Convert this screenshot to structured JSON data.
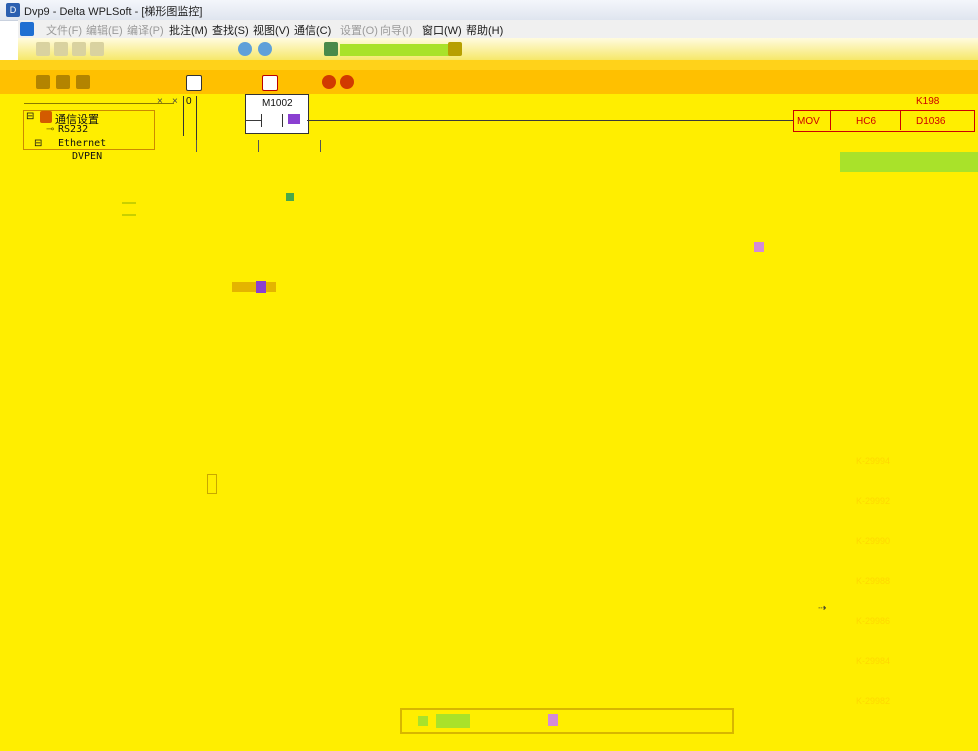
{
  "window": {
    "title": "Dvp9 - Delta WPLSoft - [梯形图监控]"
  },
  "menu": {
    "items": [
      {
        "label": "文件(F)",
        "disabled": true
      },
      {
        "label": "编辑(E)",
        "disabled": true
      },
      {
        "label": "编译(P)",
        "disabled": true
      },
      {
        "label": "批注(M)",
        "disabled": false
      },
      {
        "label": "查找(S)",
        "disabled": false
      },
      {
        "label": "视图(V)",
        "disabled": false
      },
      {
        "label": "通信(C)",
        "disabled": false
      },
      {
        "label": "设置(O)",
        "disabled": true
      },
      {
        "label": "向导(I)",
        "disabled": true
      },
      {
        "label": "窗口(W)",
        "disabled": false
      },
      {
        "label": "帮助(H)",
        "disabled": false
      }
    ]
  },
  "sidebar": {
    "root": "通信设置",
    "children": [
      "RS232",
      "Ethernet",
      "DVPEN"
    ],
    "close_glyph": "×",
    "pin_glyph": "×"
  },
  "ladder": {
    "row_number": "0",
    "contact": "M1002",
    "instruction": {
      "op": "MOV",
      "src": "HC6",
      "dst": "D1036",
      "above_label": "K198"
    }
  },
  "right_ghost_values": [
    "K-29994",
    "K-29992",
    "K-29990",
    "K-29988",
    "K-29986",
    "K-29984",
    "K-29982"
  ],
  "colors": {
    "workspace": "#ffee00",
    "toolbar": "#ffc000",
    "instruction": "#cc0000",
    "accent_green": "#a9e22a"
  }
}
